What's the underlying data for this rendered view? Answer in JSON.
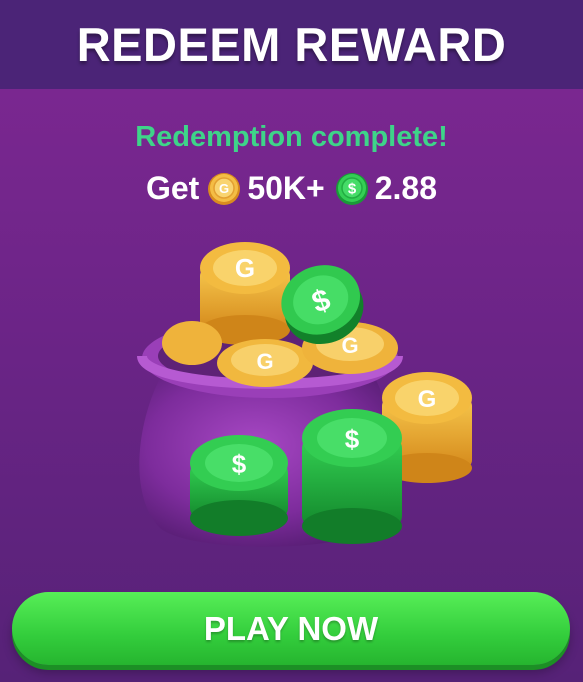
{
  "header": {
    "title": "REDEEM REWARD"
  },
  "status": {
    "message": "Redemption complete!"
  },
  "reward": {
    "prefix": "Get",
    "gold_amount": "50K+",
    "cash_amount": "2.88",
    "gold_icon": "gold-coin-icon",
    "cash_icon": "cash-coin-icon"
  },
  "illustration": {
    "icon": "coin-sack-icon"
  },
  "actions": {
    "play_label": "PLAY NOW"
  },
  "colors": {
    "header_bg": "#4b2477",
    "panel_top": "#7a2790",
    "status_green": "#3ed489",
    "button_green": "#3fdc45",
    "gold": "#f2b63a",
    "cash_green": "#2fc84a"
  }
}
